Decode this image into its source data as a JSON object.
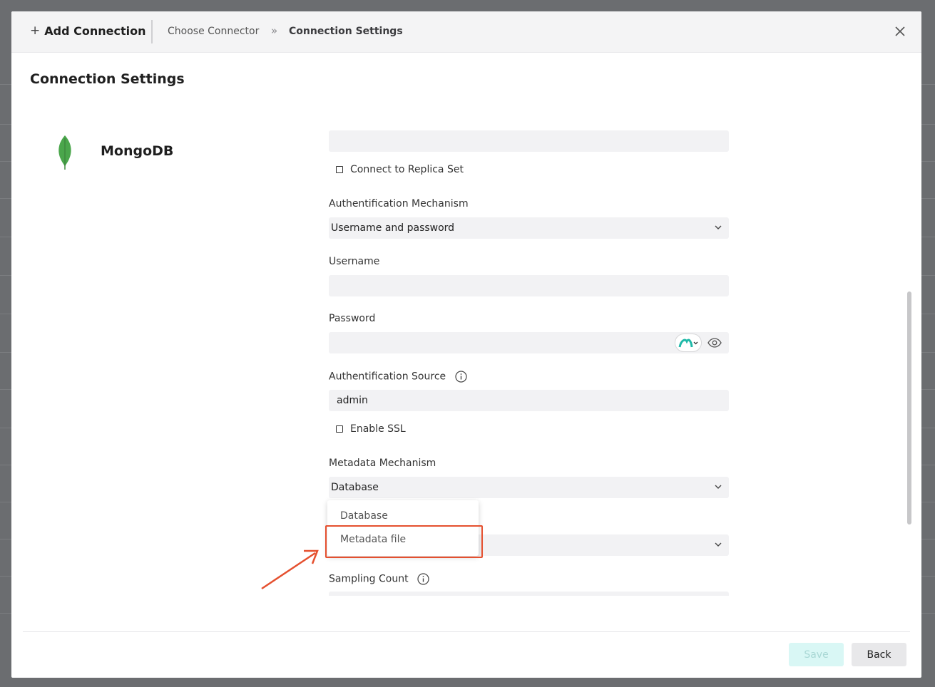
{
  "header": {
    "add_connection": "Add Connection",
    "breadcrumb": [
      "Choose Connector",
      "Connection Settings"
    ]
  },
  "page_title": "Connection Settings",
  "connector": {
    "name": "MongoDB",
    "icon": "mongodb-leaf-icon",
    "color": "#4aa64b"
  },
  "form": {
    "host_value": "",
    "replica_set_label": "Connect to Replica Set",
    "auth_mechanism_label": "Authentification Mechanism",
    "auth_mechanism_value": "Username and password",
    "username_label": "Username",
    "username_value": "",
    "password_label": "Password",
    "password_value": "",
    "auth_source_label": "Authentification Source",
    "auth_source_value": "admin",
    "enable_ssl_label": "Enable SSL",
    "metadata_mechanism_label": "Metadata Mechanism",
    "metadata_mechanism_value": "Database",
    "sampling_count_label": "Sampling Count"
  },
  "dropdown": {
    "options": [
      "Database",
      "Metadata file"
    ]
  },
  "footer": {
    "save_label": "Save",
    "back_label": "Back"
  },
  "colors": {
    "accent": "#1fb9a8",
    "highlight": "#e5502f"
  }
}
